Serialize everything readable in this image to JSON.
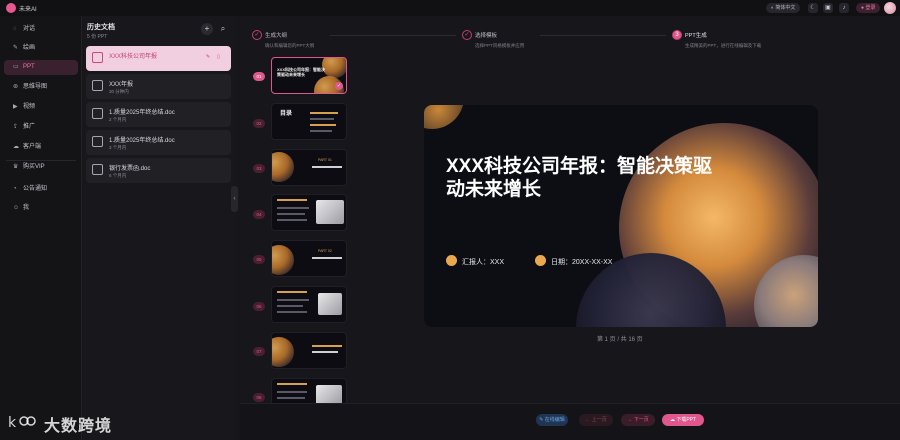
{
  "app": {
    "name": "未来AI"
  },
  "topbar": {
    "lang": "简体中文",
    "upgrade": "登录"
  },
  "nav": {
    "items": [
      {
        "label": "对话",
        "icon": "chat-icon"
      },
      {
        "label": "绘画",
        "icon": "brush-icon"
      },
      {
        "label": "PPT",
        "icon": "ppt-icon"
      },
      {
        "label": "思维导图",
        "icon": "mindmap-icon"
      },
      {
        "label": "视频",
        "icon": "video-icon"
      },
      {
        "label": "推广",
        "icon": "share-icon"
      },
      {
        "label": "客户端",
        "icon": "cloud-icon"
      },
      {
        "label": "购买VIP",
        "icon": "crown-icon"
      },
      {
        "label": "公告通知",
        "icon": "bell-icon"
      },
      {
        "label": "我",
        "icon": "user-icon"
      }
    ]
  },
  "history": {
    "title": "历史文档",
    "count": "5 份 PPT",
    "docs": [
      {
        "name": "XXX科技公司年报",
        "sub": "",
        "selected": true
      },
      {
        "name": "XXX年报",
        "sub": "30 分钟内",
        "selected": false
      },
      {
        "name": "1.质量2025年终总结.doc",
        "sub": "2 个月内",
        "selected": false
      },
      {
        "name": "1.质量2025年终总结.doc",
        "sub": "3 个月内",
        "selected": false
      },
      {
        "name": "银行发票函.doc",
        "sub": "6 个月内",
        "selected": false
      }
    ]
  },
  "steps": [
    {
      "n": "✓",
      "title": "生成大纲",
      "sub": "确认和编辑您的PPT大纲",
      "current": false
    },
    {
      "n": "✓",
      "title": "选择模板",
      "sub": "选择PPT风格模板并应用",
      "current": false
    },
    {
      "n": "3",
      "title": "PPT生成",
      "sub": "生成精美的PPT，进行在线编辑及下载",
      "current": true
    }
  ],
  "thumbs": [
    "01",
    "02",
    "03",
    "04",
    "05",
    "06",
    "07",
    "08"
  ],
  "thumb_texts": {
    "t1": "XXX科技公司年报：智能决策驱动未来增长",
    "t2": "目录",
    "t3": "PART 01",
    "t5": "PART 02"
  },
  "slide": {
    "title": "XXX科技公司年报：智能决策驱动未来增长",
    "reporter_label": "汇报人：XXX",
    "date_label": "日期：20XX-XX-XX"
  },
  "pager": "第 1 页 / 共 16 页",
  "bottom": {
    "edit": "在线编辑",
    "prev": "上一页",
    "next": "下一页",
    "download": "下载PPT"
  },
  "watermark": "大数跨境",
  "colors": {
    "accent": "#e0578d",
    "gold": "#e9a84d",
    "bg": "#17171b"
  }
}
